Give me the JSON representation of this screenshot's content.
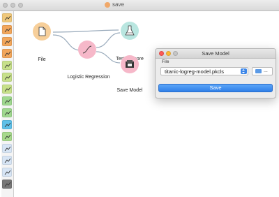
{
  "window": {
    "title": "save"
  },
  "toolbox": {
    "tools": [
      {
        "name": "data-table-tool",
        "color": "#f0c87a"
      },
      {
        "name": "distributions-tool",
        "color": "#f2a65b"
      },
      {
        "name": "hierarchy-tool",
        "color": "#f2a65b"
      },
      {
        "name": "network-tool",
        "color": "#f2a65b"
      },
      {
        "name": "scatter-tool",
        "color": "#c7e08a"
      },
      {
        "name": "image-tool",
        "color": "#c7e08a"
      },
      {
        "name": "line-tool",
        "color": "#c7e08a"
      },
      {
        "name": "cross-tool",
        "color": "#9fd88f"
      },
      {
        "name": "dots-tool",
        "color": "#9fd88f"
      },
      {
        "name": "curve-tool",
        "color": "#5fc0e8"
      },
      {
        "name": "scatter-plus-tool",
        "color": "#a7d98c"
      },
      {
        "name": "graduation-tool",
        "color": "#d7e5f5"
      },
      {
        "name": "arc-tool",
        "color": "#d7e5f5"
      },
      {
        "name": "bars-tool",
        "color": "#d7e5f5"
      },
      {
        "name": "document-tool",
        "color": "#777777"
      }
    ]
  },
  "canvas": {
    "nodes": [
      {
        "id": "file",
        "label": "File",
        "color": "#f7cf9a"
      },
      {
        "id": "logreg",
        "label": "Logistic Regression",
        "color": "#f6b8c9"
      },
      {
        "id": "test-score",
        "label": "Test & Score",
        "color": "#b9e6e0"
      },
      {
        "id": "save-model",
        "label": "Save Model",
        "color": "#f6b8c9"
      }
    ]
  },
  "dialog": {
    "title": "Save Model",
    "file_label": "File",
    "selected_file": "titanic-logreg-model.pkcls",
    "browse_label": "...",
    "save_label": "Save"
  }
}
